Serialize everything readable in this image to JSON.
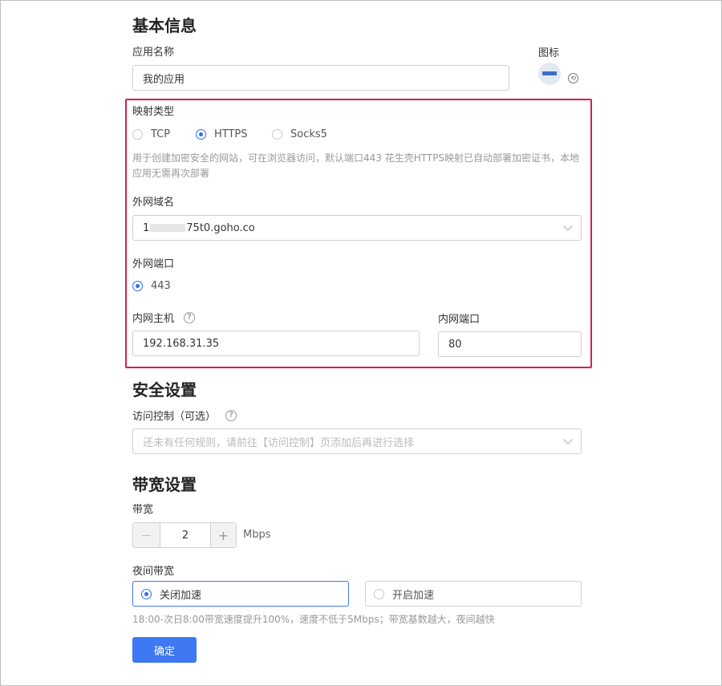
{
  "basic": {
    "title": "基本信息",
    "app_name_label": "应用名称",
    "app_name_value": "我的应用",
    "icon_label": "图标"
  },
  "mapping": {
    "type_label": "映射类型",
    "options": [
      "TCP",
      "HTTPS",
      "Socks5"
    ],
    "selected": "HTTPS",
    "description_line1": "用于创建加密安全的网站，可在浏览器访问，默认端口443 花生壳HTTPS映射已自动部署加密证书，本地",
    "description_line2": "应用无需再次部署",
    "domain_label": "外网域名",
    "domain_prefix": "1",
    "domain_suffix": "75t0.goho.co",
    "port_label": "外网端口",
    "port_value": "443",
    "host_label": "内网主机",
    "host_value": "192.168.31.35",
    "inner_port_label": "内网端口",
    "inner_port_value": "80"
  },
  "security": {
    "title": "安全设置",
    "access_label": "访问控制（可选）",
    "access_placeholder": "还未有任何规则，请前往【访问控制】页添加后再进行选择"
  },
  "bandwidth": {
    "title": "带宽设置",
    "bw_label": "带宽",
    "bw_value": "2",
    "bw_unit": "Mbps",
    "minus": "—",
    "plus": "+",
    "night_label": "夜间带宽",
    "night_options": [
      "关闭加速",
      "开启加速"
    ],
    "night_selected": "关闭加速",
    "night_hint": "18:00-次日8:00带宽速度提升100%，速度不低于5Mbps；带宽基数越大，夜间越快"
  },
  "actions": {
    "confirm": "确定"
  },
  "colors": {
    "accent": "#3e78f2",
    "highlight_border": "#d81b60"
  }
}
